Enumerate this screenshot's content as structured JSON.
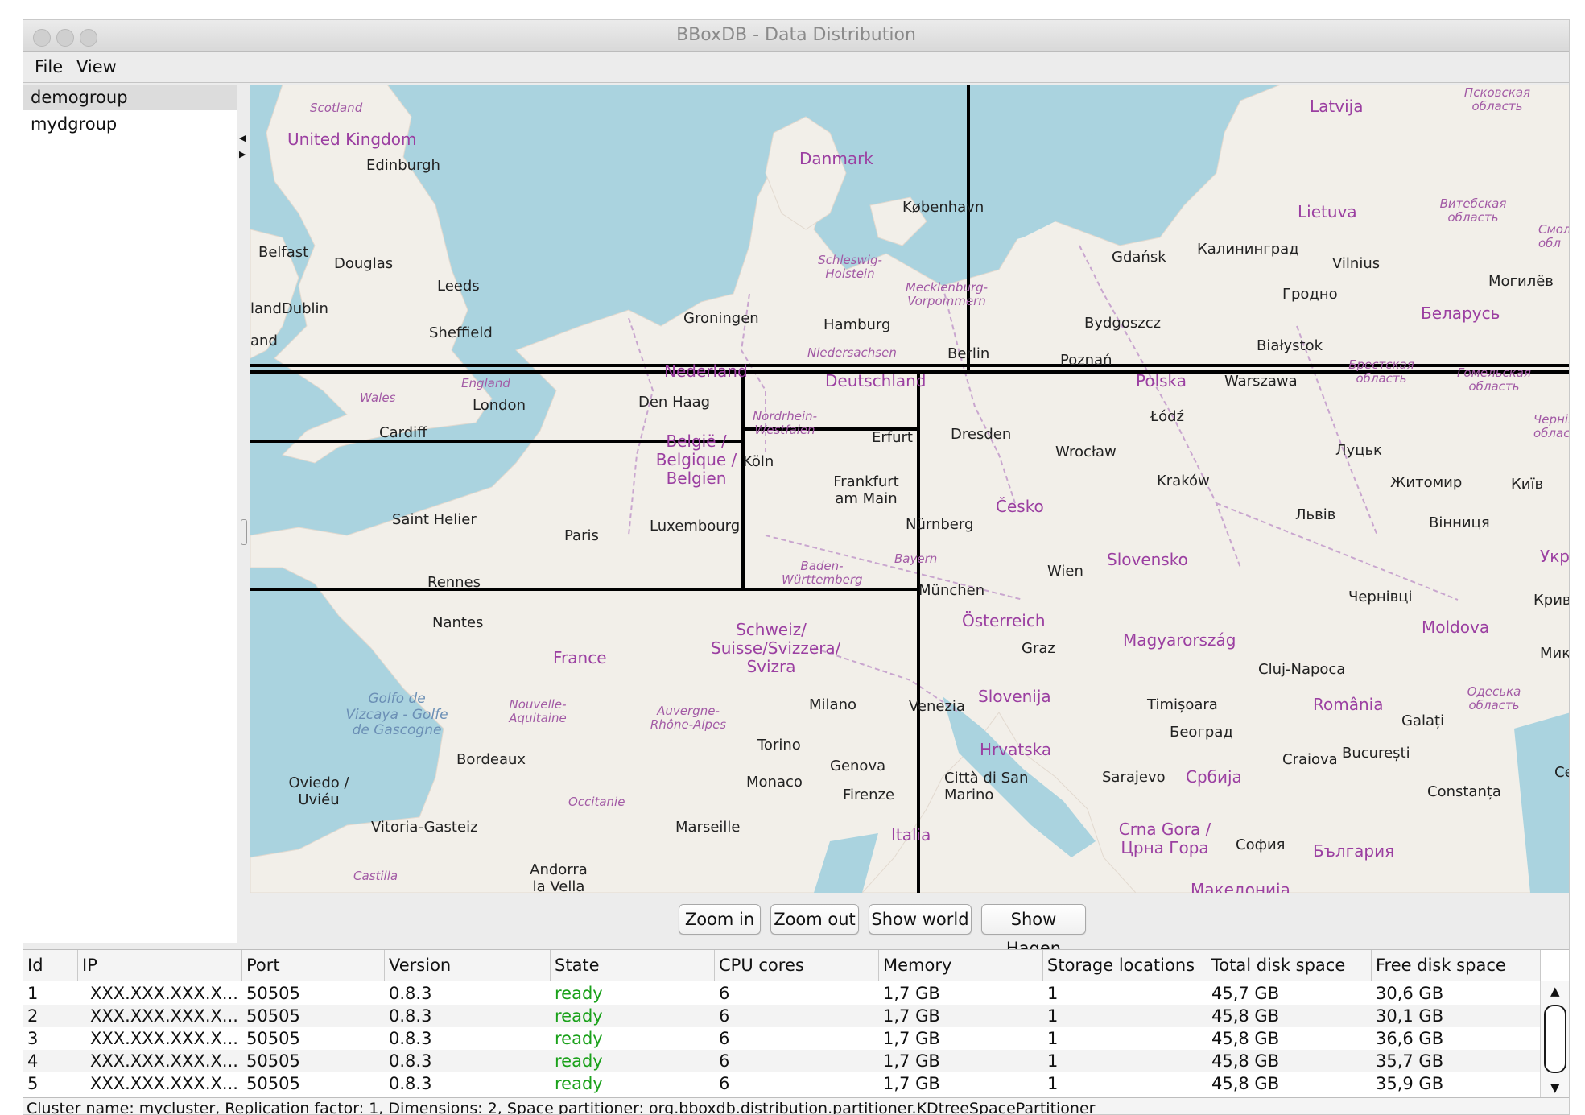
{
  "window": {
    "title": "BBoxDB - Data Distribution"
  },
  "menu": {
    "items": [
      "File",
      "View"
    ]
  },
  "sidebar": {
    "groups": [
      {
        "label": "demogroup",
        "selected": true
      },
      {
        "label": "mydgroup",
        "selected": false
      }
    ]
  },
  "map": {
    "colors": {
      "water": "#aad3df",
      "land": "#f2efe9",
      "border": "#b98fbf",
      "partition_line": "#000000"
    },
    "labels": {
      "countries": [
        "United Kingdom",
        "Danmark",
        "Latvija",
        "Lietuva",
        "Беларусь",
        "Nederland",
        "Deutschland",
        "Polska",
        "België / Belgique / Belgien",
        "Česko",
        "Slovensko",
        "France",
        "Schweiz/ Suisse/Svizzera/ Svizra",
        "Österreich",
        "Magyarország",
        "Moldova",
        "România",
        "Slovenija",
        "Hrvatska",
        "Србија",
        "Crna Gora / Црна Гора",
        "България",
        "Italia",
        "Укр"
      ],
      "regions": [
        "Scotland",
        "Wales",
        "England",
        "Schleswig-Holstein",
        "Mecklenburg-Vorpommern",
        "Niedersachsen",
        "Nordrhein-Westfalen",
        "Baden-Württemberg",
        "Bayern",
        "Nouvelle-Aquitaine",
        "Auvergne-Rhône-Alpes",
        "Occitanie",
        "Castilla",
        "Псковская область",
        "Витебская область",
        "Смоле обл",
        "Брестская область",
        "Гомельская область",
        "Чернігів област",
        "Одеська область"
      ],
      "seas": [
        "Golfo de Vizcaya - Golfe de Gascogne"
      ],
      "cities": [
        "Edinburgh",
        "Belfast",
        "Douglas",
        "Leeds",
        "landDublin",
        "and",
        "Sheffield",
        "København",
        "Groningen",
        "Hamburg",
        "Berlin",
        "Gdańsk",
        "Калининград",
        "Vilnius",
        "Гродно",
        "Могилёв",
        "Bydgoszcz",
        "Białystok",
        "Poznań",
        "Warszawa",
        "London",
        "Den Haag",
        "Cardiff",
        "Erfurt",
        "Dresden",
        "Łódź",
        "Wrocław",
        "Köln",
        "Frankfurt am Main",
        "Kraków",
        "Луцьк",
        "Житомир",
        "Київ",
        "Saint Helier",
        "Paris",
        "Luxembourg",
        "Nürnberg",
        "Львів",
        "Вінниця",
        "Rennes",
        "München",
        "Wien",
        "Чернівці",
        "Кривий",
        "Nantes",
        "Graz",
        "Cluj-Napoca",
        "Микола",
        "Milano",
        "Venezia",
        "Timișoara",
        "Galați",
        "Torino",
        "Београд",
        "Craiova",
        "București",
        "Bordeaux",
        "Genova",
        "Monaco",
        "Firenze",
        "Città di San Marino",
        "Sarajevo",
        "Constanța",
        "Ce",
        "Oviedo / Uviéu",
        "Vitoria-Gasteiz",
        "Marseille",
        "Andorra la Vella",
        "София",
        "Македонија"
      ]
    }
  },
  "buttons": {
    "zoom_in": "Zoom in",
    "zoom_out": "Zoom out",
    "show_world": "Show world",
    "show_hagen": "Show Hagen"
  },
  "table": {
    "headers": [
      "Id",
      "IP",
      "Port",
      "Version",
      "State",
      "CPU cores",
      "Memory",
      "Storage locations",
      "Total disk space",
      "Free disk space"
    ],
    "rows": [
      [
        "1",
        "XXX.XXX.XXX.X...",
        "50505",
        "0.8.3",
        "ready",
        "6",
        "1,7 GB",
        "1",
        "45,7 GB",
        "30,6 GB"
      ],
      [
        "2",
        "XXX.XXX.XXX.X...",
        "50505",
        "0.8.3",
        "ready",
        "6",
        "1,7 GB",
        "1",
        "45,8 GB",
        "30,1 GB"
      ],
      [
        "3",
        "XXX.XXX.XXX.X...",
        "50505",
        "0.8.3",
        "ready",
        "6",
        "1,7 GB",
        "1",
        "45,8 GB",
        "36,6 GB"
      ],
      [
        "4",
        "XXX.XXX.XXX.X...",
        "50505",
        "0.8.3",
        "ready",
        "6",
        "1,7 GB",
        "1",
        "45,8 GB",
        "35,7 GB"
      ],
      [
        "5",
        "XXX.XXX.XXX.X...",
        "50505",
        "0.8.3",
        "ready",
        "6",
        "1,7 GB",
        "1",
        "45,8 GB",
        "35,9 GB"
      ]
    ]
  },
  "status": {
    "text": "Cluster name: mycluster, Replication factor: 1, Dimensions: 2, Space partitioner: org.bboxdb.distribution.partitioner.KDtreeSpacePartitioner"
  }
}
